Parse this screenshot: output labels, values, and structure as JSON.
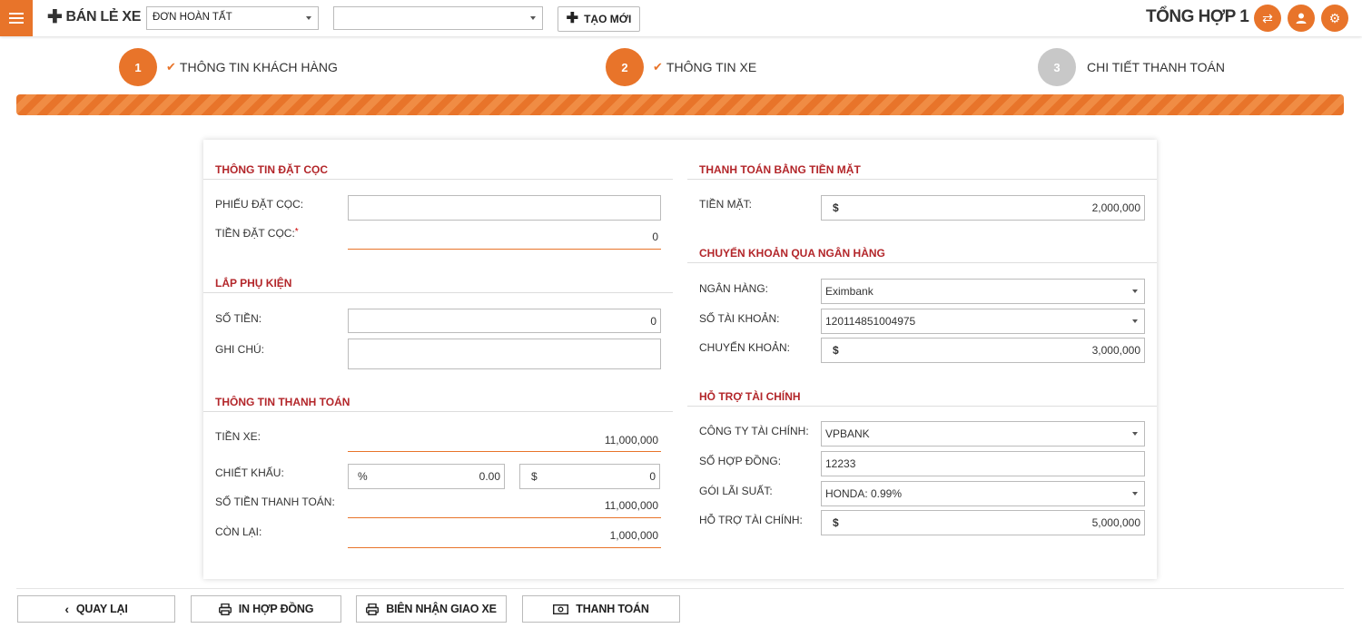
{
  "header": {
    "brand": "BÁN LẺ XE",
    "order_status": "ĐƠN HOÀN TẤT",
    "second_select": "",
    "new_button": "TẠO MỚI",
    "store": "TỔNG HỢP 1"
  },
  "steps": [
    {
      "number": "1",
      "label": "THÔNG TIN KHÁCH HÀNG",
      "done": true
    },
    {
      "number": "2",
      "label": "THÔNG TIN XE",
      "done": true
    },
    {
      "number": "3",
      "label": "CHI TIẾT THANH TOÁN",
      "done": false
    }
  ],
  "deposit": {
    "title": "THÔNG TIN ĐẶT CỌC",
    "voucher_label": "PHIẾU ĐẶT CỌC:",
    "voucher_value": "",
    "amount_label": "TIỀN ĐẶT CỌC:",
    "required_mark": "*",
    "amount_value": "0"
  },
  "accessories": {
    "title": "LẮP PHỤ KIỆN",
    "amount_label": "SỐ TIỀN:",
    "amount_value": "0",
    "note_label": "GHI CHÚ:",
    "note_value": ""
  },
  "payment_info": {
    "title": "THÔNG TIN THANH TOÁN",
    "price_label": "TIỀN XE:",
    "price_value": "11,000,000",
    "discount_label": "CHIẾT KHẤU:",
    "discount_percent_symbol": "%",
    "discount_percent": "0.00",
    "discount_currency_symbol": "$",
    "discount_amount": "0",
    "total_label": "SỐ TIỀN THANH TOÁN:",
    "total_value": "11,000,000",
    "remaining_label": "CÒN LẠI:",
    "remaining_value": "1,000,000"
  },
  "cash": {
    "title": "THANH TOÁN BẰNG TIỀN MẶT",
    "label": "TIỀN MẶT:",
    "currency": "$",
    "value": "2,000,000"
  },
  "bank": {
    "title": "CHUYỂN KHOẢN QUA NGÂN HÀNG",
    "bank_label": "NGÂN HÀNG:",
    "bank_value": "Eximbank",
    "account_label": "SỐ TÀI KHOẢN:",
    "account_value": "120114851004975",
    "transfer_label": "CHUYỂN KHOẢN:",
    "transfer_currency": "$",
    "transfer_value": "3,000,000"
  },
  "finance": {
    "title": "HỖ TRỢ TÀI CHÍNH",
    "company_label": "CÔNG TY TÀI CHÍNH:",
    "company_value": "VPBANK",
    "contract_label": "SỐ HỢP ĐỒNG:",
    "contract_value": "12233",
    "rate_label": "GÓI LÃI SUẤT:",
    "rate_value": "HONDA: 0.99%",
    "support_label": "HỖ TRỢ TÀI CHÍNH:",
    "support_currency": "$",
    "support_value": "5,000,000"
  },
  "footer": {
    "back": "QUAY LẠI",
    "print_contract": "IN HỢP ĐỒNG",
    "delivery_receipt": "BIÊN NHẬN GIAO XE",
    "checkout": "THANH TOÁN"
  },
  "colors": {
    "accent": "#e8742a",
    "section_title": "#b3262a",
    "step_pending": "#c8c8c8"
  }
}
